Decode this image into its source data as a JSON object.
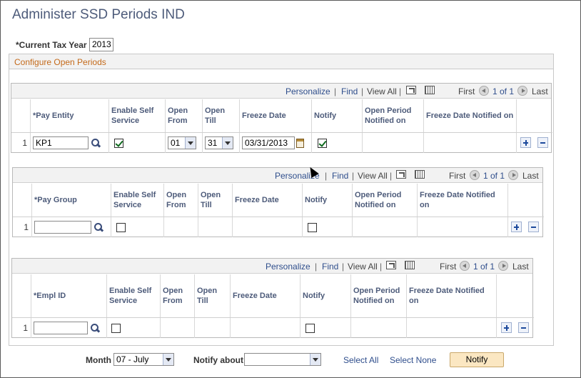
{
  "page": {
    "title": "Administer SSD Periods IND"
  },
  "tax_year": {
    "label": "*Current Tax Year",
    "value": "2013"
  },
  "section_title": "Configure Open Periods",
  "nav_labels": {
    "personalize": "Personalize",
    "find": "Find",
    "view_all": "View All",
    "sep": "|",
    "first": "First",
    "range": "1 of 1",
    "last": "Last"
  },
  "grid1": {
    "headers": [
      "*Pay Entity",
      "Enable Self Service",
      "Open From",
      "Open Till",
      "Freeze Date",
      "Notify",
      "Open Period Notified on",
      "Freeze Date Notified on"
    ],
    "row": {
      "num": "1",
      "entity": "KP1",
      "enable": true,
      "open_from": "01",
      "open_till": "31",
      "freeze_date": "03/31/2013",
      "notify": true
    }
  },
  "grid2": {
    "headers": [
      "*Pay Group",
      "Enable Self Service",
      "Open From",
      "Open Till",
      "Freeze Date",
      "Notify",
      "Open Period Notified on",
      "Freeze Date Notified on"
    ],
    "row": {
      "num": "1",
      "value": "",
      "enable": false,
      "notify": false
    }
  },
  "grid3": {
    "headers": [
      "*Empl ID",
      "Enable Self Service",
      "Open From",
      "Open Till",
      "Freeze Date",
      "Notify",
      "Open Period Notified on",
      "Freeze Date Notified on"
    ],
    "row": {
      "num": "1",
      "value": "",
      "enable": false,
      "notify": false
    }
  },
  "bottom": {
    "month_label": "Month",
    "month_value": "07 - July",
    "notify_about_label": "Notify about",
    "notify_about_value": "",
    "select_all": "Select All",
    "select_none": "Select None",
    "notify_button": "Notify"
  },
  "icons": {
    "lookup": "magnifier-icon",
    "calendar": "calendar-icon",
    "zoom": "new-window-icon",
    "download": "download-grid-icon",
    "add": "plus-icon",
    "delete": "minus-icon"
  },
  "colors": {
    "title": "#4d5b7a",
    "link": "#2f4e8c",
    "section_title": "#c46a1a",
    "check": "#0f6b1e",
    "notify_button": "#fbe7c2"
  }
}
